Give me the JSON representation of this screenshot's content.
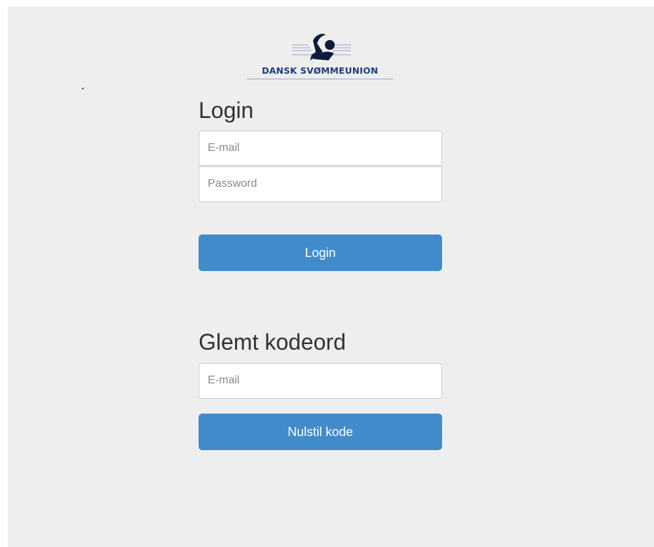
{
  "logo": {
    "text": "DANSK SVØMMEUNION",
    "icon": "swimmer-icon",
    "color": "#1d3e78"
  },
  "login": {
    "heading": "Login",
    "email_placeholder": "E-mail",
    "password_placeholder": "Password",
    "button_label": "Login"
  },
  "forgot": {
    "heading": "Glemt kodeord",
    "email_placeholder": "E-mail",
    "button_label": "Nulstil kode"
  },
  "colors": {
    "background": "#eeeeee",
    "primary_button": "#428bca",
    "heading_text": "#333333"
  }
}
